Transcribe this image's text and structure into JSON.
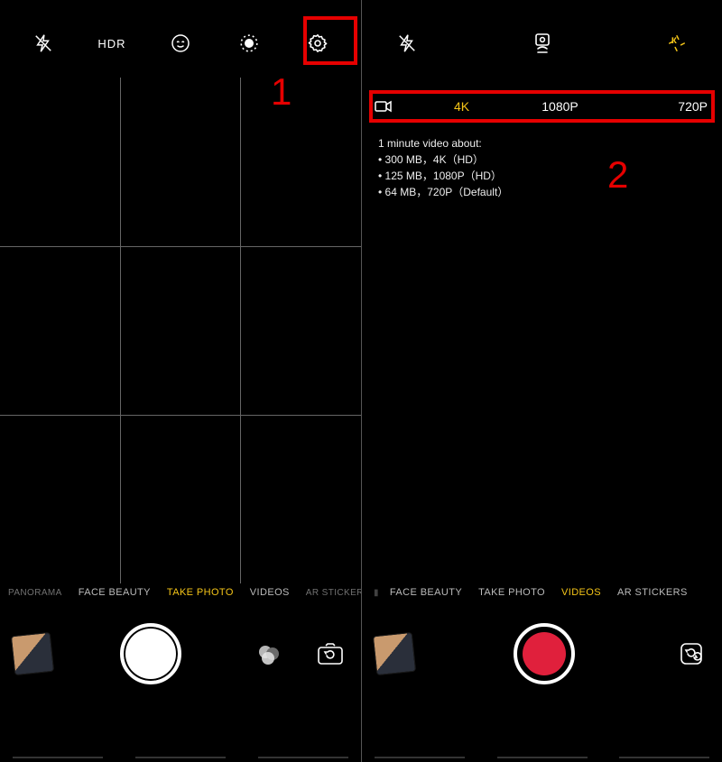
{
  "left": {
    "topbar": {
      "hdr_label": "HDR"
    },
    "grid": {
      "v1": 33.3,
      "v2": 66.6,
      "h1": 33.3,
      "h2": 66.6
    },
    "modes": {
      "items": [
        "PANORAMA",
        "FACE BEAUTY",
        "TAKE PHOTO",
        "VIDEOS",
        "AR STICKERS"
      ],
      "active_index": 2
    },
    "callout": {
      "number": "1"
    }
  },
  "right": {
    "resolution": {
      "options": [
        "4K",
        "1080P",
        "720P"
      ],
      "active_index": 0
    },
    "info": {
      "title": "1 minute video about:",
      "lines": [
        "300 MB，4K（HD）",
        "125 MB，1080P（HD）",
        "64 MB，720P（Default）"
      ]
    },
    "modes": {
      "items": [
        "FACE BEAUTY",
        "TAKE PHOTO",
        "VIDEOS",
        "AR STICKERS"
      ],
      "active_index": 2
    },
    "callout": {
      "number": "2"
    }
  },
  "colors": {
    "callout_red": "#e60000",
    "accent_yellow": "#f5c518",
    "record_red": "#e0203c"
  }
}
